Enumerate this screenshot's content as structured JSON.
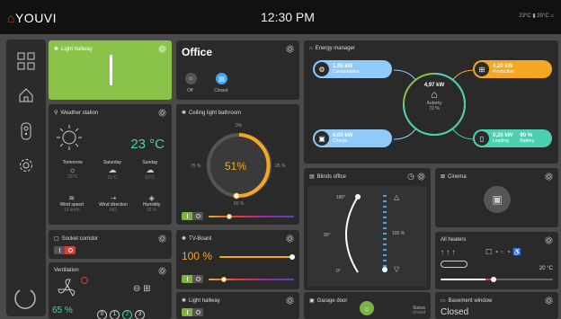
{
  "app": {
    "brand": "YOUVI",
    "time": "12:30 PM",
    "status": {
      "outside_temp": "23°C",
      "inside_temp": "20°C"
    }
  },
  "light_hallway_top": {
    "title": "Light hallway"
  },
  "office": {
    "title": "Office",
    "scene1_label": "Off",
    "scene2_label": "Closed"
  },
  "weather": {
    "title": "Weather station",
    "temperature": "23 °C",
    "forecast": [
      {
        "day": "Tomorrow",
        "temp": "25°C"
      },
      {
        "day": "Saturday",
        "temp": "21°C"
      },
      {
        "day": "Sunday",
        "temp": "19°C"
      }
    ],
    "metrics": [
      {
        "label": "Wind speed",
        "value": "13 km/h"
      },
      {
        "label": "Wind direction",
        "value": "NO"
      },
      {
        "label": "Humidity",
        "value": "32 %"
      }
    ]
  },
  "ceiling_light": {
    "title": "Ceiling light bathroom",
    "value": "51%",
    "level": 0.51,
    "tick_top": "0%",
    "tick_left": "75 %",
    "tick_right": "25 %",
    "tick_bottom": "50 %"
  },
  "energy": {
    "title": "Energy manager",
    "consumption": {
      "value": "1,95 kW",
      "label": "Consumption"
    },
    "production": {
      "value": "4,20 kW",
      "label": "Production"
    },
    "charge": {
      "value": "0,00 kW",
      "label": "Charge"
    },
    "battery": {
      "value": "0,20 kW",
      "label": "Loading",
      "pct": "90 %",
      "pct_label": "Battery"
    },
    "center": {
      "value": "4,97 kW",
      "label": "Autarky",
      "pct": "72 %"
    }
  },
  "blinds": {
    "title": "Blinds office",
    "top_label": "180°",
    "mid_label": "90°",
    "bottom_label": "0°",
    "pct_label": "100 %"
  },
  "cinema": {
    "title": "Cinema"
  },
  "socket": {
    "title": "Socket corridor"
  },
  "tv_board": {
    "title": "TV-Board",
    "value": "100 %",
    "level": 1.0
  },
  "all_heaters": {
    "title": "All heaters",
    "temp": "20 °C"
  },
  "ventilation": {
    "title": "Ventilation",
    "value": "65 %",
    "levels": [
      "0",
      "1",
      "2",
      "3"
    ]
  },
  "light_hallway_bottom": {
    "title": "Light hallway"
  },
  "garage": {
    "title": "Garage door",
    "status_label": "Status",
    "status_value": "closed"
  },
  "basement": {
    "title": "Basement window",
    "value": "Closed"
  },
  "colors": {
    "green": "#8bc34a",
    "orange": "#f5a623",
    "blue": "#90caf9",
    "teal": "#4dd0b1",
    "red": "#e53935"
  }
}
